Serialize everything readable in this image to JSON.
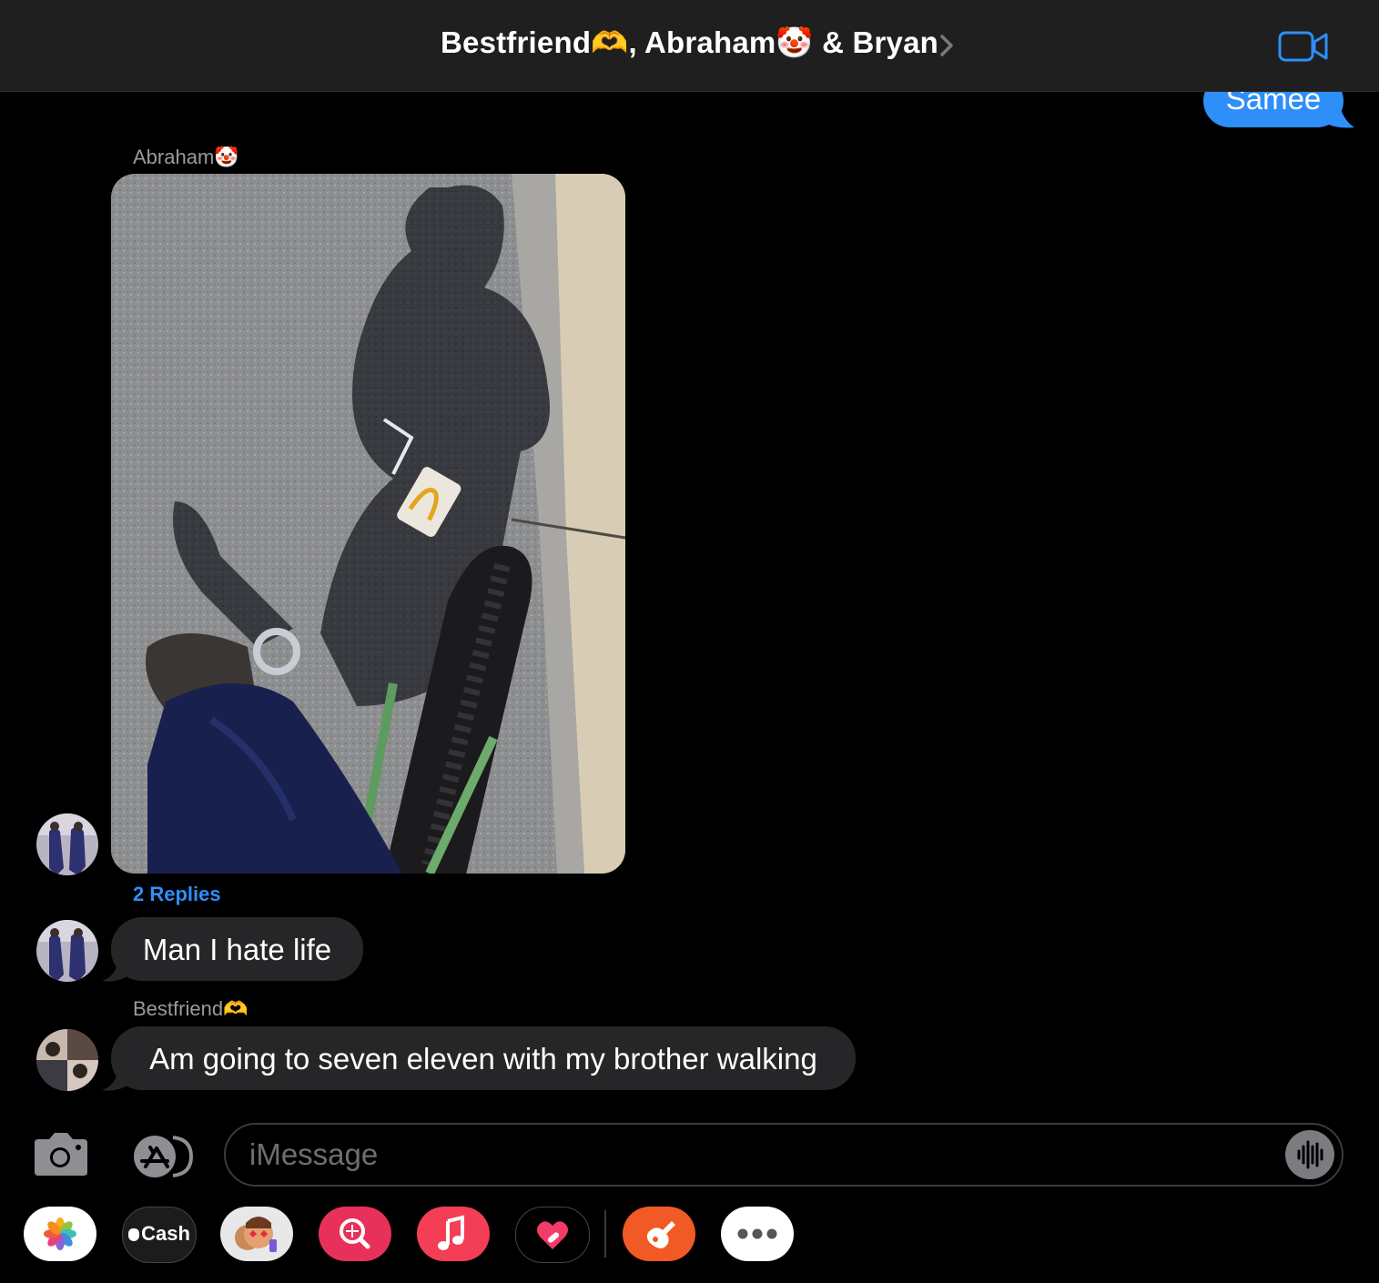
{
  "header": {
    "title": "Bestfriend🫶, Abraham🤡 & Bryan",
    "colors": {
      "accent": "#2e8ff8",
      "bar": "#1f1f1f"
    }
  },
  "messages": [
    {
      "type": "outgoing",
      "text": "Samee"
    },
    {
      "type": "incoming-photo",
      "sender": "Abraham🤡",
      "replies": "2 Replies"
    },
    {
      "type": "incoming",
      "text": "Man I hate life"
    },
    {
      "type": "incoming",
      "sender": "Bestfriend🫶",
      "text": "Am going to seven eleven with my brother walking"
    }
  ],
  "input": {
    "placeholder": "iMessage"
  },
  "tray": {
    "apps": [
      "photos-icon",
      "apple-cash-icon",
      "memoji-icon",
      "image-search-icon",
      "music-icon",
      "digital-touch-icon",
      "garageband-icon",
      "more-icon"
    ],
    "cash_label": "Cash"
  }
}
